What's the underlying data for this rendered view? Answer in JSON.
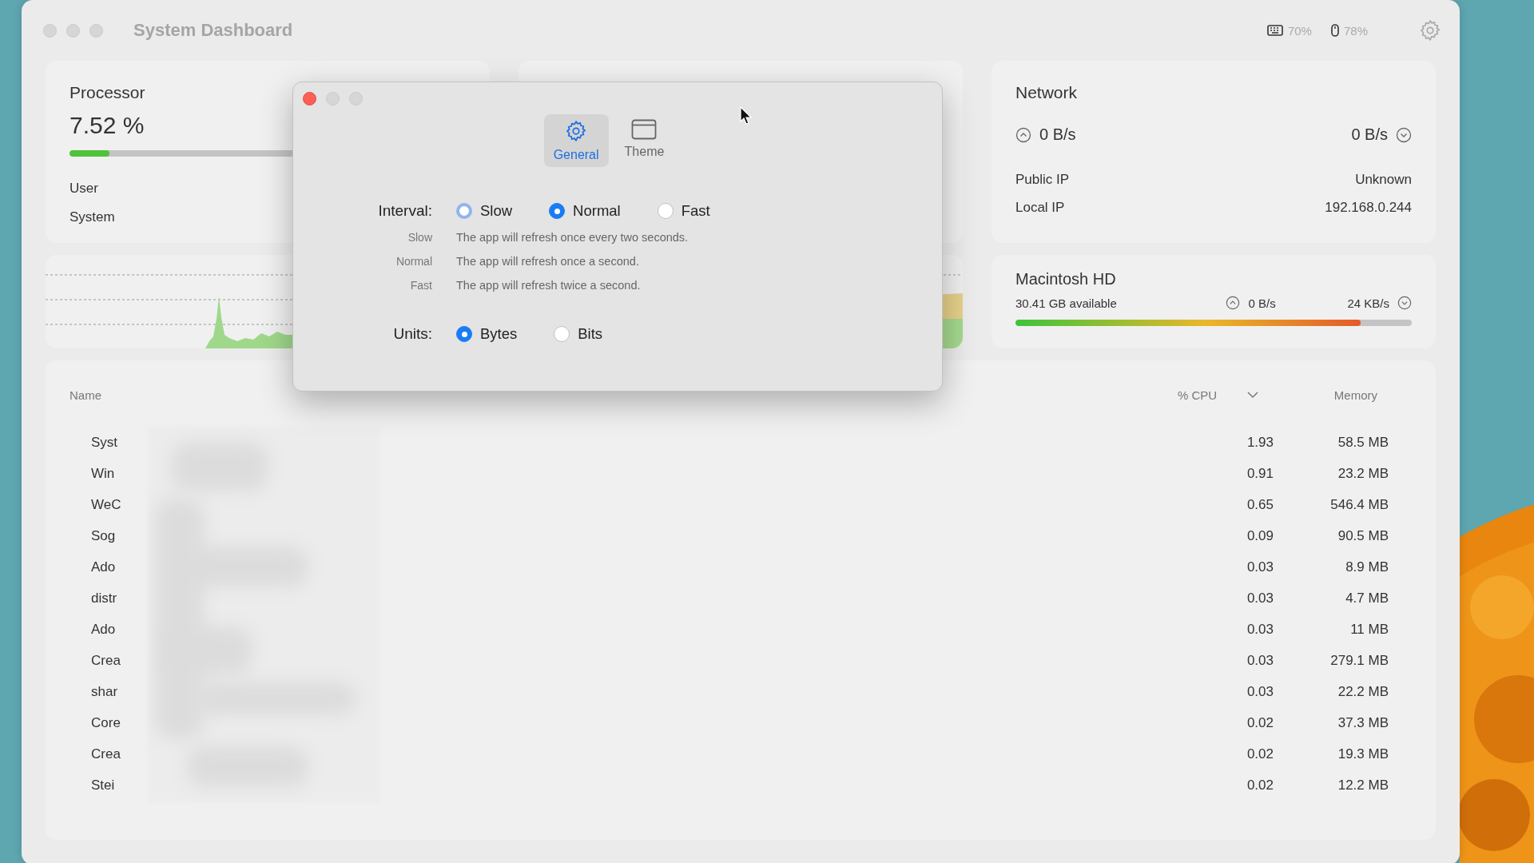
{
  "window": {
    "title": "System Dashboard"
  },
  "status": [
    {
      "kind": "keyboard",
      "reading": "70%"
    },
    {
      "kind": "mouse",
      "reading": "78%"
    }
  ],
  "processor": {
    "title": "Processor",
    "usage": "7.52 %",
    "level": 0.09,
    "rows": [
      "User",
      "System"
    ]
  },
  "network": {
    "title": "Network",
    "upload": "0 B/s",
    "download": "0 B/s",
    "rows": [
      {
        "label": "Public IP",
        "value": "Unknown"
      },
      {
        "label": "Local IP",
        "value": "192.168.0.244"
      }
    ]
  },
  "disk": {
    "title": "Macintosh HD",
    "available": "30.41 GB available",
    "read": "0 B/s",
    "write": "24 KB/s",
    "level": 0.87
  },
  "table": {
    "columns": [
      {
        "label": "Name",
        "sorted": false
      },
      {
        "label": "% CPU",
        "sorted": true
      },
      {
        "label": "Memory",
        "sorted": false
      }
    ],
    "rows": [
      {
        "name": "Syst",
        "cpu": "1.93",
        "memory": "58.5 MB"
      },
      {
        "name": "Win",
        "cpu": "0.91",
        "memory": "23.2 MB"
      },
      {
        "name": "WeC",
        "cpu": "0.65",
        "memory": "546.4 MB"
      },
      {
        "name": "Sog",
        "cpu": "0.09",
        "memory": "90.5 MB"
      },
      {
        "name": "Ado",
        "cpu": "0.03",
        "memory": "8.9 MB"
      },
      {
        "name": "distr",
        "cpu": "0.03",
        "memory": "4.7 MB"
      },
      {
        "name": "Ado",
        "cpu": "0.03",
        "memory": "11 MB"
      },
      {
        "name": "Crea",
        "cpu": "0.03",
        "memory": "279.1 MB"
      },
      {
        "name": "shar",
        "cpu": "0.03",
        "memory": "22.2 MB"
      },
      {
        "name": "Core",
        "cpu": "0.02",
        "memory": "37.3 MB"
      },
      {
        "name": "Crea",
        "cpu": "0.02",
        "memory": "19.3 MB"
      },
      {
        "name": "Stei",
        "cpu": "0.02",
        "memory": "12.2 MB"
      }
    ]
  },
  "dialog": {
    "tabs": [
      {
        "label": "General",
        "kind": "gear",
        "selected": true
      },
      {
        "label": "Theme",
        "kind": "window",
        "selected": false
      }
    ],
    "interval": {
      "label": "Interval:",
      "options": [
        {
          "label": "Slow",
          "selected": false,
          "focused": true
        },
        {
          "label": "Normal",
          "selected": true,
          "focused": false
        },
        {
          "label": "Fast",
          "selected": false,
          "focused": false
        }
      ]
    },
    "descriptions": [
      {
        "label": "Slow",
        "text": "The app will refresh once every two seconds."
      },
      {
        "label": "Normal",
        "text": "The app will refresh once a second."
      },
      {
        "label": "Fast",
        "text": "The app will refresh twice a second."
      }
    ],
    "units": {
      "label": "Units:",
      "options": [
        {
          "label": "Bytes",
          "selected": true,
          "focused": false
        },
        {
          "label": "Bits",
          "selected": false,
          "focused": false
        }
      ]
    }
  }
}
